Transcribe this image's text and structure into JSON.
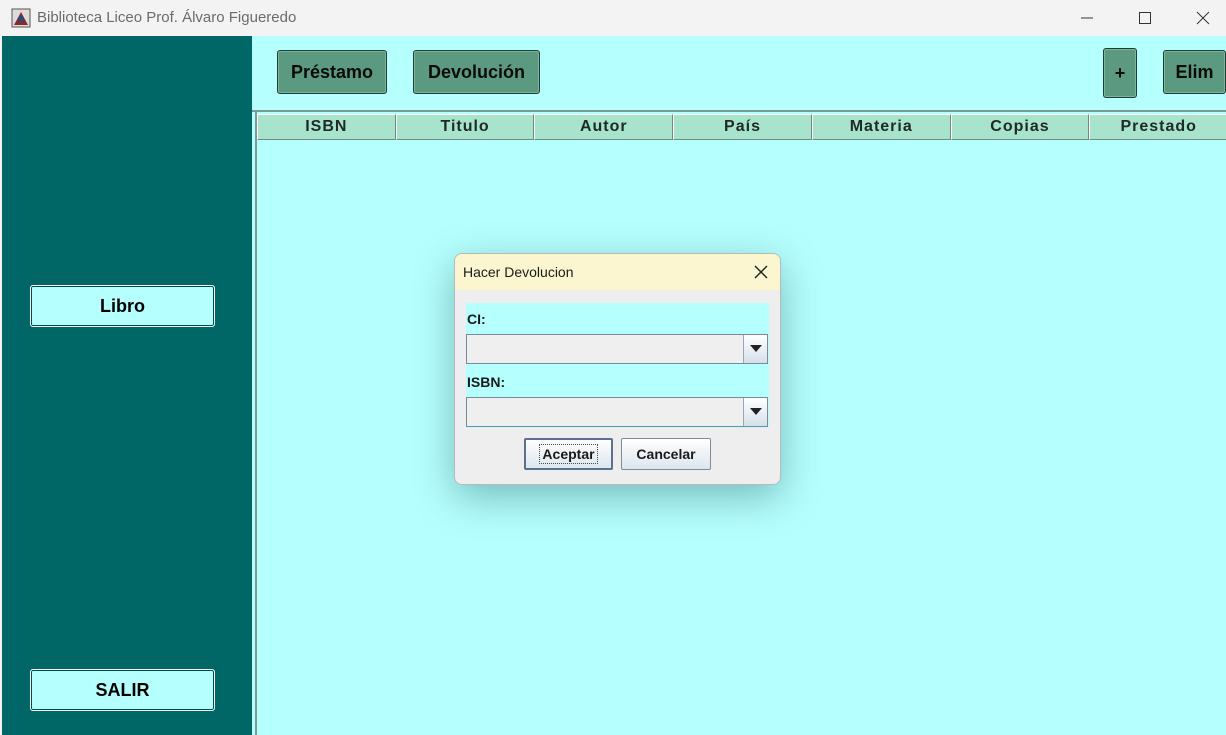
{
  "window": {
    "title": "Biblioteca Liceo Prof. Álvaro Figueredo"
  },
  "sidebar": {
    "libro_label": "Libro",
    "salir_label": "SALIR"
  },
  "toolbar": {
    "prestamo_label": "Préstamo",
    "devolucion_label": "Devolución",
    "add_label": "+",
    "elim_label": "Elim"
  },
  "table": {
    "columns": [
      "ISBN",
      "Titulo",
      "Autor",
      "País",
      "Materia",
      "Copias",
      "Prestado"
    ]
  },
  "dialog": {
    "title": "Hacer Devolucion",
    "ci_label": "CI:",
    "ci_value": "",
    "isbn_label": "ISBN:",
    "isbn_value": "",
    "accept_label": "Aceptar",
    "cancel_label": "Cancelar"
  },
  "colors": {
    "sidebar_bg": "#006666",
    "main_bg": "#b6ffff",
    "toolbar_button": "#5b9a80",
    "header_cell": "#a8e4cc",
    "dialog_title_bg": "#fbf6cf"
  }
}
